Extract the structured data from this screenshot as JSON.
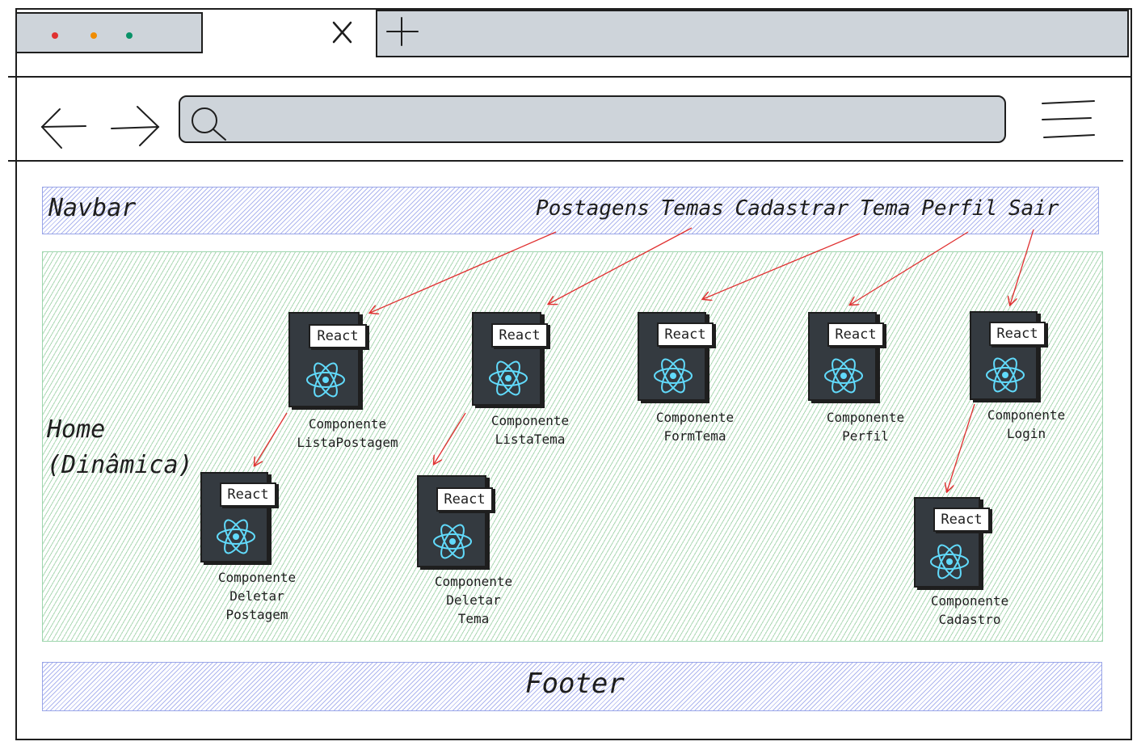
{
  "sections": {
    "navbar": "Navbar",
    "home_line1": "Home",
    "home_line2": "(Dinâmica)",
    "footer": "Footer",
    "nav_links": "Postagens Temas Cadastrar Tema Perfil Sair"
  },
  "react_label": "React",
  "components": {
    "lista_postagem": [
      "Componente",
      "ListaPostagem"
    ],
    "lista_tema": [
      "Componente",
      "ListaTema"
    ],
    "form_tema": [
      "Componente",
      "FormTema"
    ],
    "perfil": [
      "Componente",
      "Perfil"
    ],
    "login": [
      "Componente",
      "Login"
    ],
    "deletar_postagem": [
      "Componente",
      "Deletar",
      "Postagem"
    ],
    "deletar_tema": [
      "Componente",
      "Deletar",
      "Tema"
    ],
    "cadastro": [
      "Componente",
      "Cadastro"
    ]
  },
  "icons": {
    "tab_dots": [
      "red-dot",
      "orange-dot",
      "green-dot"
    ],
    "close": "close-icon",
    "new_tab": "plus-icon",
    "back": "arrow-left-icon",
    "forward": "arrow-right-icon",
    "search": "search-icon",
    "menu": "hamburger-menu-icon",
    "react": "react-atom-icon"
  },
  "colors": {
    "stroke": "#1e1e1e",
    "chrome_gray": "#ced4da",
    "navbar_hatch": "#4a5cdc",
    "home_hatch": "#2f9e44",
    "book": "#343a40",
    "react_cyan": "#61dafb",
    "arrow_red": "#e03131",
    "dot_red": "#e03131",
    "dot_orange": "#f08c00",
    "dot_green": "#099268"
  }
}
